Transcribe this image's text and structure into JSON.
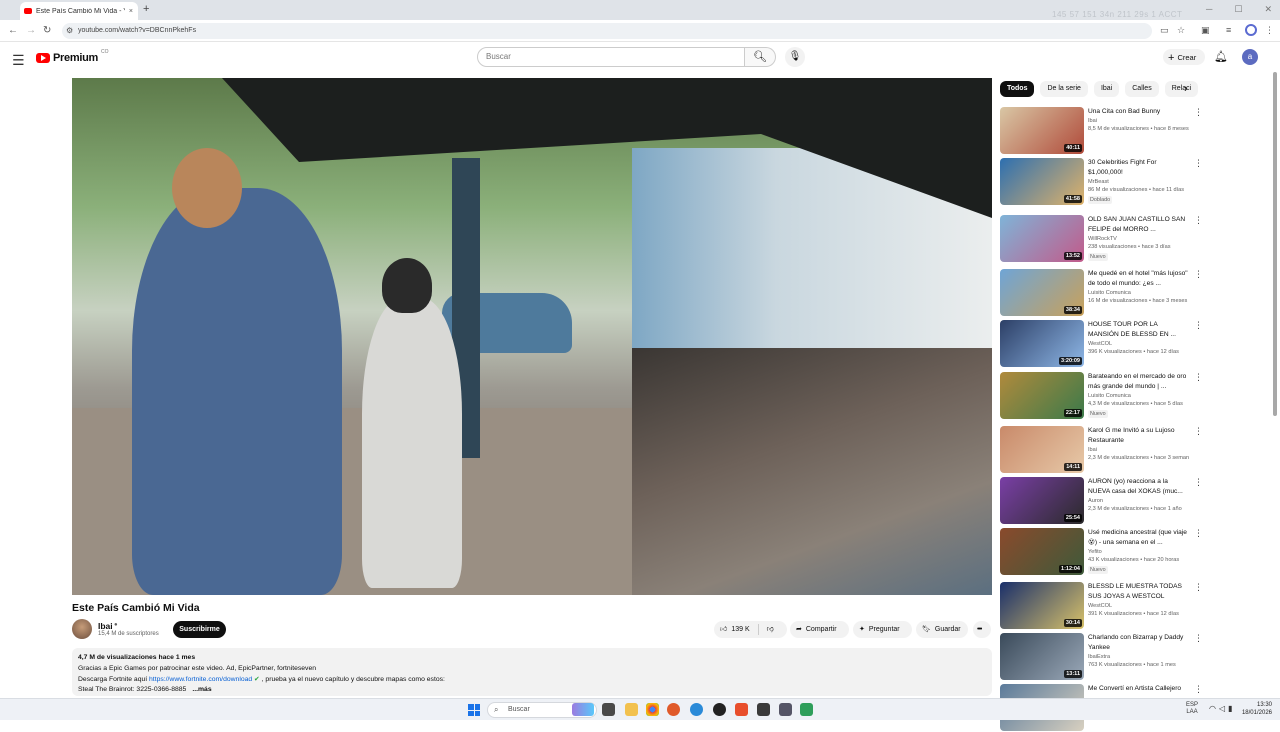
{
  "browser": {
    "tab_title": "Este País Cambió Mi Vida - Yo",
    "tab_close": "×",
    "new_tab": "+",
    "url": "youtube.com/watch?v=DBCnnPkehFs",
    "ghost_overlay": "145 57    151 34n    211 29s    1 ACCT"
  },
  "masthead": {
    "logo_text": "Premium",
    "logo_super": "CO",
    "search_placeholder": "Buscar",
    "create_label": "Crear",
    "avatar_letter": "a"
  },
  "video": {
    "title": "Este País Cambió Mi Vida",
    "channel": "Ibai",
    "subscribers": "15,4 M de suscriptores",
    "subscribe_label": "Suscribirme",
    "likes": "139 K",
    "share_label": "Compartir",
    "ask_label": "Preguntar",
    "save_label": "Guardar",
    "more_label": "•••"
  },
  "description": {
    "views_line": "4,7 M de visualizaciones  hace 1 mes",
    "line1": "Gracias a Epic Games por patrocinar este video. Ad, EpicPartner, fortniteseven",
    "line2_prefix": "Descarga Fortnite aquí ",
    "line2_link": "https://www.fortnite.com/download",
    "line2_suffix": " , prueba ya el nuevo capítulo y descubre mapas como estos:",
    "line3": "Steal The Brainrot: 3225-0366-8885",
    "more": "...más"
  },
  "chips": [
    "Todos",
    "De la serie",
    "Ibai",
    "Calles",
    "Relaci"
  ],
  "recommendations": [
    {
      "title": "Una Cita con Bad Bunny",
      "channel": "Ibai",
      "meta": "8,5 M de visualizaciones • hace 8 meses",
      "duration": "40:11",
      "badge": "",
      "c1": "#d9c7a5",
      "c2": "#b04a3a"
    },
    {
      "title": "30 Celebrities Fight For $1,000,000!",
      "channel": "MrBeast",
      "meta": "86 M de visualizaciones • hace 11 días",
      "duration": "41:58",
      "badge": "Doblado",
      "c1": "#2d6fb0",
      "c2": "#e0b36a"
    },
    {
      "title": "OLD SAN JUAN CASTILLO SAN FELIPE del MORRO ...",
      "channel": "WillRockTV",
      "meta": "238 visualizaciones • hace 3 días",
      "duration": "13:52",
      "badge": "Nuevo",
      "c1": "#7fb4d8",
      "c2": "#c25a8a"
    },
    {
      "title": "Me quedé en el hotel \"más lujoso\" de todo el mundo: ¿es ...",
      "channel": "Luisito Comunica",
      "meta": "16 M de visualizaciones • hace 3 meses",
      "duration": "38:34",
      "badge": "",
      "c1": "#6fa5d6",
      "c2": "#c9a15a"
    },
    {
      "title": "HOUSE TOUR POR LA MANSIÓN DE BLESSD EN ...",
      "channel": "WestCOL",
      "meta": "396 K visualizaciones • hace 12 días",
      "duration": "3:20:09",
      "badge": "",
      "c1": "#2c3f66",
      "c2": "#8fb8e8"
    },
    {
      "title": "Barateando en el mercado de oro más grande del mundo | ...",
      "channel": "Luisito Comunica",
      "meta": "4,3 M de visualizaciones • hace 5 días",
      "duration": "22:17",
      "badge": "Nuevo",
      "c1": "#b08a3c",
      "c2": "#3b7a4a"
    },
    {
      "title": "Karol G me Invitó a su Lujoso Restaurante",
      "channel": "Ibai",
      "meta": "2,3 M de visualizaciones • hace 3 seman",
      "duration": "14:11",
      "badge": "",
      "c1": "#c98a6a",
      "c2": "#e7c9a8"
    },
    {
      "title": "AURON (yo) reacciona a la NUEVA casa del XOKAS (muc...",
      "channel": "Auron",
      "meta": "2,3 M de visualizaciones • hace 1 año",
      "duration": "25:54",
      "badge": "",
      "c1": "#7a3fa6",
      "c2": "#2a2a2a"
    },
    {
      "title": "Usé medicina ancestral (que viaje 😵) - una semana en el ...",
      "channel": "Yefito",
      "meta": "43 K visualizaciones • hace 20 horas",
      "duration": "1:12:04",
      "badge": "Nuevo",
      "c1": "#8a4a2c",
      "c2": "#3e5a3a"
    },
    {
      "title": "BLESSD LE MUESTRA TODAS SUS JOYAS A WESTCOL",
      "channel": "WestCOL",
      "meta": "391 K visualizaciones • hace 12 días",
      "duration": "30:14",
      "badge": "",
      "c1": "#1a2f6a",
      "c2": "#d8c26a"
    },
    {
      "title": "Charlando con Bizarrap y Daddy Yankee",
      "channel": "IbaiExtra",
      "meta": "763 K visualizaciones • hace 1 mes",
      "duration": "13:11",
      "badge": "",
      "c1": "#3a4a5a",
      "c2": "#9aa8b8"
    },
    {
      "title": "Me Convertí en Artista Callejero",
      "channel": "",
      "meta": "",
      "duration": "",
      "badge": "",
      "c1": "#5a7a9a",
      "c2": "#d8d0c0"
    }
  ],
  "taskbar": {
    "search_placeholder": "Buscar",
    "lang_top": "ESP",
    "lang_bottom": "LAA",
    "time": "13:30",
    "date": "18/01/2026"
  }
}
